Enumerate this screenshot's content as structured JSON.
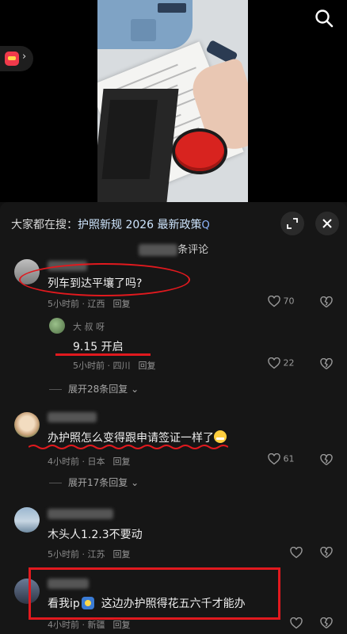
{
  "search_bar": {
    "prefix": "大家都在搜：",
    "keyword": "护照新规 2026 最新政策",
    "search_symbol": "Q",
    "expand_icon": "expand-icon",
    "close_icon": "close-icon"
  },
  "comment_count": {
    "blurred": "■■■■",
    "suffix": "条评论"
  },
  "comments": [
    {
      "text": "列车到达平壤了吗?",
      "time": "5小时前 · 辽西",
      "reply": "回复",
      "likes": "70",
      "reply_item": {
        "username": "大 叔 呀",
        "text": "9.15 开启",
        "time": "5小时前 · 四川",
        "reply": "回复",
        "likes": "22"
      },
      "expand": "展开28条回复"
    },
    {
      "text": "办护照怎么变得跟申请签证一样了",
      "time": "4小时前 · 日本",
      "reply": "回复",
      "likes": "61",
      "expand": "展开17条回复"
    },
    {
      "text": "木头人1.2.3不要动",
      "time": "5小时前 · 江苏",
      "reply": "回复"
    },
    {
      "text_before": "看我ip",
      "text_after": "这边办护照得花五六千才能办",
      "time": "4小时前 · 新疆",
      "reply": "回复"
    }
  ],
  "colors": {
    "annotation_red": "#e1191e",
    "panel_bg": "#161616",
    "stamp_red": "#d8231f"
  }
}
